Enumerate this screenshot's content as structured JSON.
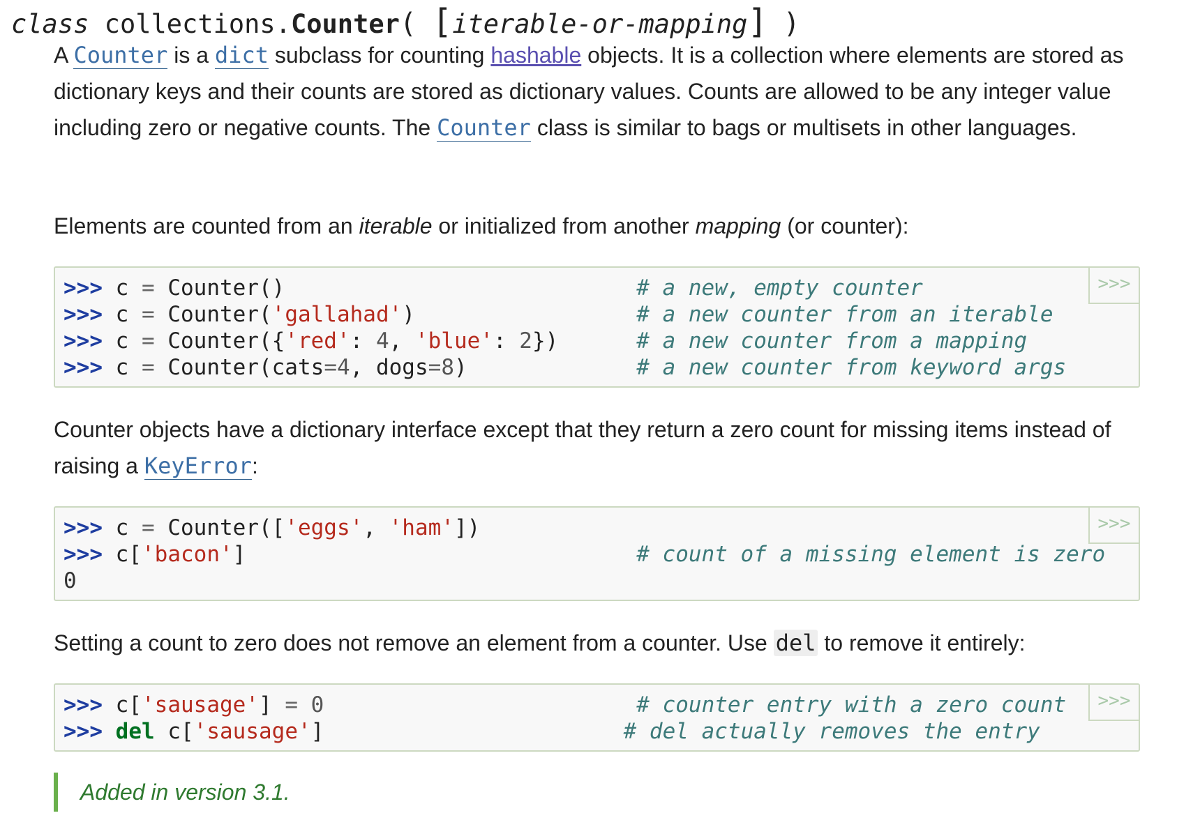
{
  "signature": {
    "keyword": "class",
    "module": "collections.",
    "name": "Counter",
    "open_paren": "(",
    "open_bracket": "[",
    "param": "iterable-or-mapping",
    "close_bracket": "]",
    "close_paren": ")"
  },
  "para1": {
    "t1": "A ",
    "link_counter": "Counter",
    "t2": " is a ",
    "link_dict": "dict",
    "t3": " subclass for counting ",
    "link_hashable": "hashable",
    "t4": " objects. It is a collection where elements are stored as dictionary keys and their counts are stored as dictionary values. Counts are allowed to be any integer value including zero or negative counts. The ",
    "link_counter2": "Counter",
    "t5": " class is similar to bags or multisets in other languages."
  },
  "para2": {
    "t1": "Elements are counted from an ",
    "em1": "iterable",
    "t2": " or initialized from another ",
    "em2": "mapping",
    "t3": " (or counter):"
  },
  "code1": {
    "prompt": ">>>",
    "copy_label": ">>>",
    "lines": [
      {
        "a": "c ",
        "op": "=",
        "b": " Counter()",
        "comment": "# a new, empty counter"
      },
      {
        "a": "c ",
        "op": "=",
        "b": " Counter(",
        "s": "'gallahad'",
        "c": ")",
        "comment": "# a new counter from an iterable"
      },
      {
        "comment": "# a new counter from a mapping"
      },
      {
        "comment": "# a new counter from keyword args"
      }
    ]
  },
  "para3": {
    "t1": "Counter objects have a dictionary interface except that they return a zero count for missing items instead of raising a ",
    "link_keyerror": "KeyError",
    "t2": ":"
  },
  "code2": {
    "copy_label": ">>>",
    "comment": "# count of a missing element is zero",
    "output": "0"
  },
  "para4": {
    "t1": "Setting a count to zero does not remove an element from a counter. Use ",
    "code": "del",
    "t2": " to remove it entirely:"
  },
  "code3": {
    "copy_label": ">>>",
    "comment1": "# counter entry with a zero count",
    "comment2": "# del actually removes the entry"
  },
  "versionadded": "Added in version 3.1."
}
